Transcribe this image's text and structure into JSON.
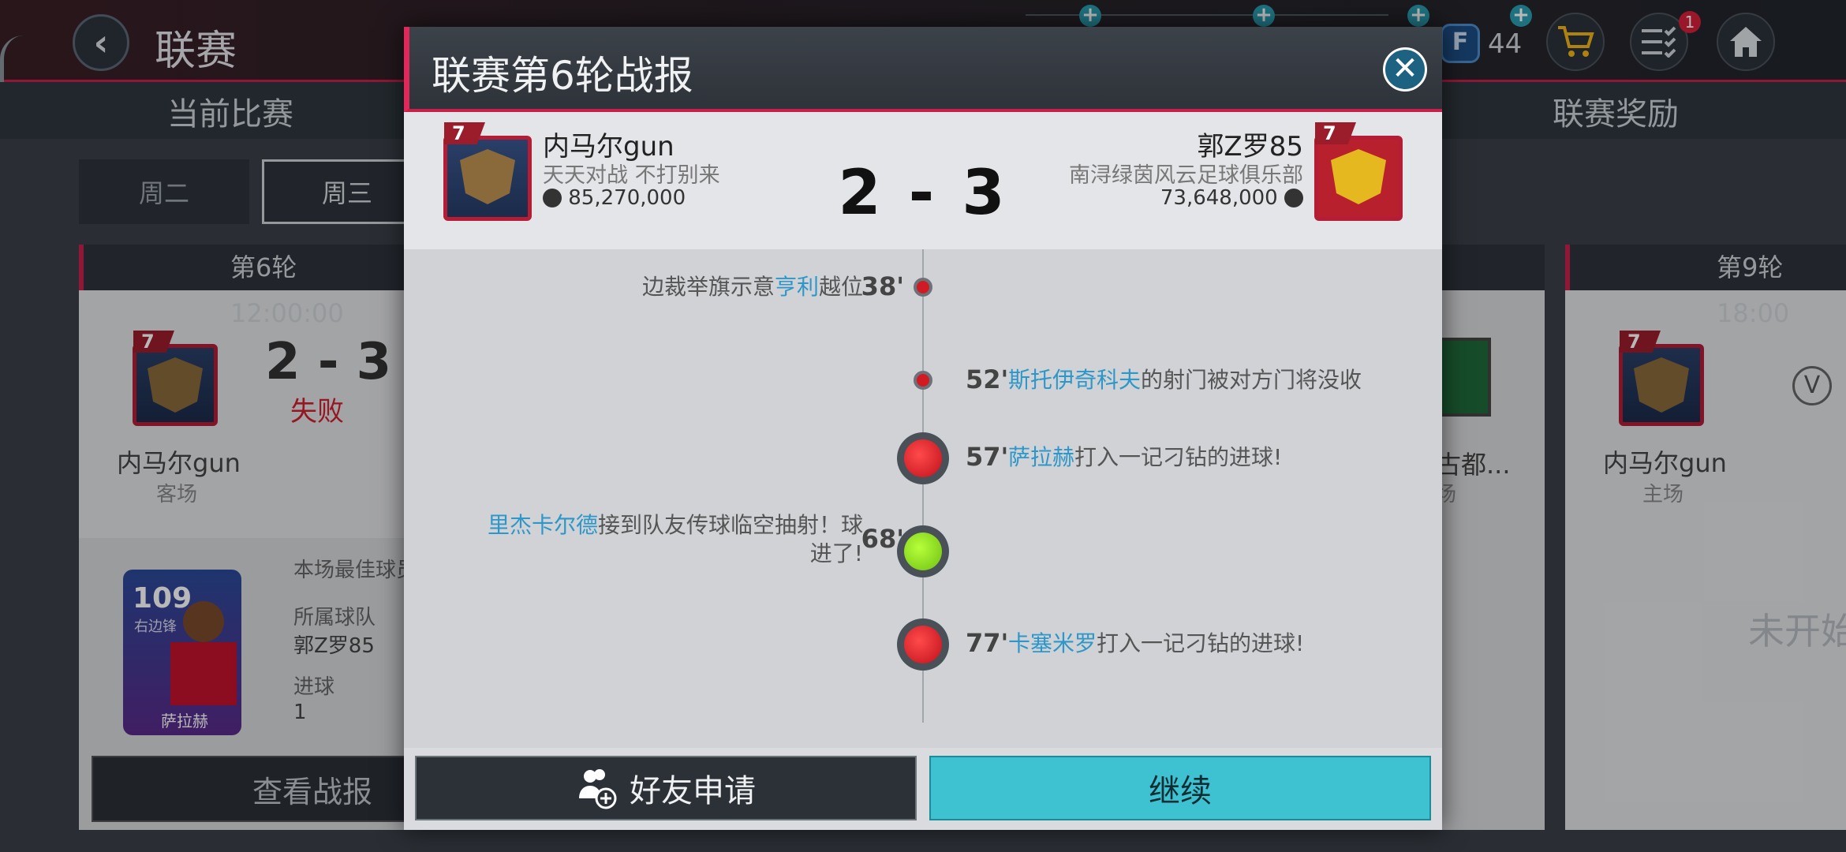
{
  "header": {
    "title": "联赛",
    "back_icon": "‹"
  },
  "tabs": [
    "当前比赛",
    "联赛奖励"
  ],
  "currency": {
    "icon_letter": "F",
    "count": "44"
  },
  "notification_badge": "1",
  "days": [
    "周二",
    "周三"
  ],
  "cards": {
    "left": {
      "round": "第6轮 12:00:00",
      "score": "2 - 3",
      "result": "失败",
      "team": "内马尔gun",
      "venue": "客场",
      "best_player_label": "本场最佳球员",
      "team_label": "所属球队",
      "player_team": "郭Z罗85",
      "goals_label": "进球",
      "goals": "1",
      "player_rating": "109",
      "player_pos": "右边锋",
      "player_name": "萨拉赫",
      "view_report": "查看战报"
    },
    "middle_partial": {
      "team": "古都...",
      "venue": "场"
    },
    "right": {
      "round": "第9轮 18:00",
      "team": "内马尔gun",
      "venue": "主场",
      "vs": "V",
      "status": "未开始"
    }
  },
  "dialog": {
    "title": "联赛第6轮战报",
    "close_icon": "✕",
    "home": {
      "name": "内马尔gun",
      "motto": "天天对战 不打别来",
      "value": "85,270,000"
    },
    "away": {
      "name": "郭Z罗85",
      "club": "南浔绿茵风云足球俱乐部",
      "value": "73,648,000"
    },
    "score": "2 - 3",
    "events": [
      {
        "side": "left",
        "minute": "38'",
        "pre": "边裁举旗示意",
        "player": "亨利",
        "post": "越位",
        "type": "offside"
      },
      {
        "side": "right",
        "minute": "52'",
        "pre": "",
        "player": "斯托伊奇科夫",
        "post": "的射门被对方门将没收",
        "type": "save"
      },
      {
        "side": "right",
        "minute": "57'",
        "pre": "",
        "player": "萨拉赫",
        "post": "打入一记刁钻的进球!",
        "type": "away-goal"
      },
      {
        "side": "left",
        "minute": "68'",
        "pre": "",
        "player": "里杰卡尔德",
        "post": "接到队友传球临空抽射！球进了!",
        "type": "home-goal"
      },
      {
        "side": "right",
        "minute": "77'",
        "pre": "",
        "player": "卡塞米罗",
        "post": "打入一记刁钻的进球!",
        "type": "away-goal"
      }
    ],
    "friend_button": "好友申请",
    "continue_button": "继续"
  },
  "colors": {
    "accent": "#c8204a",
    "highlight": "#2c97c8",
    "continue": "#3ec2d2"
  }
}
